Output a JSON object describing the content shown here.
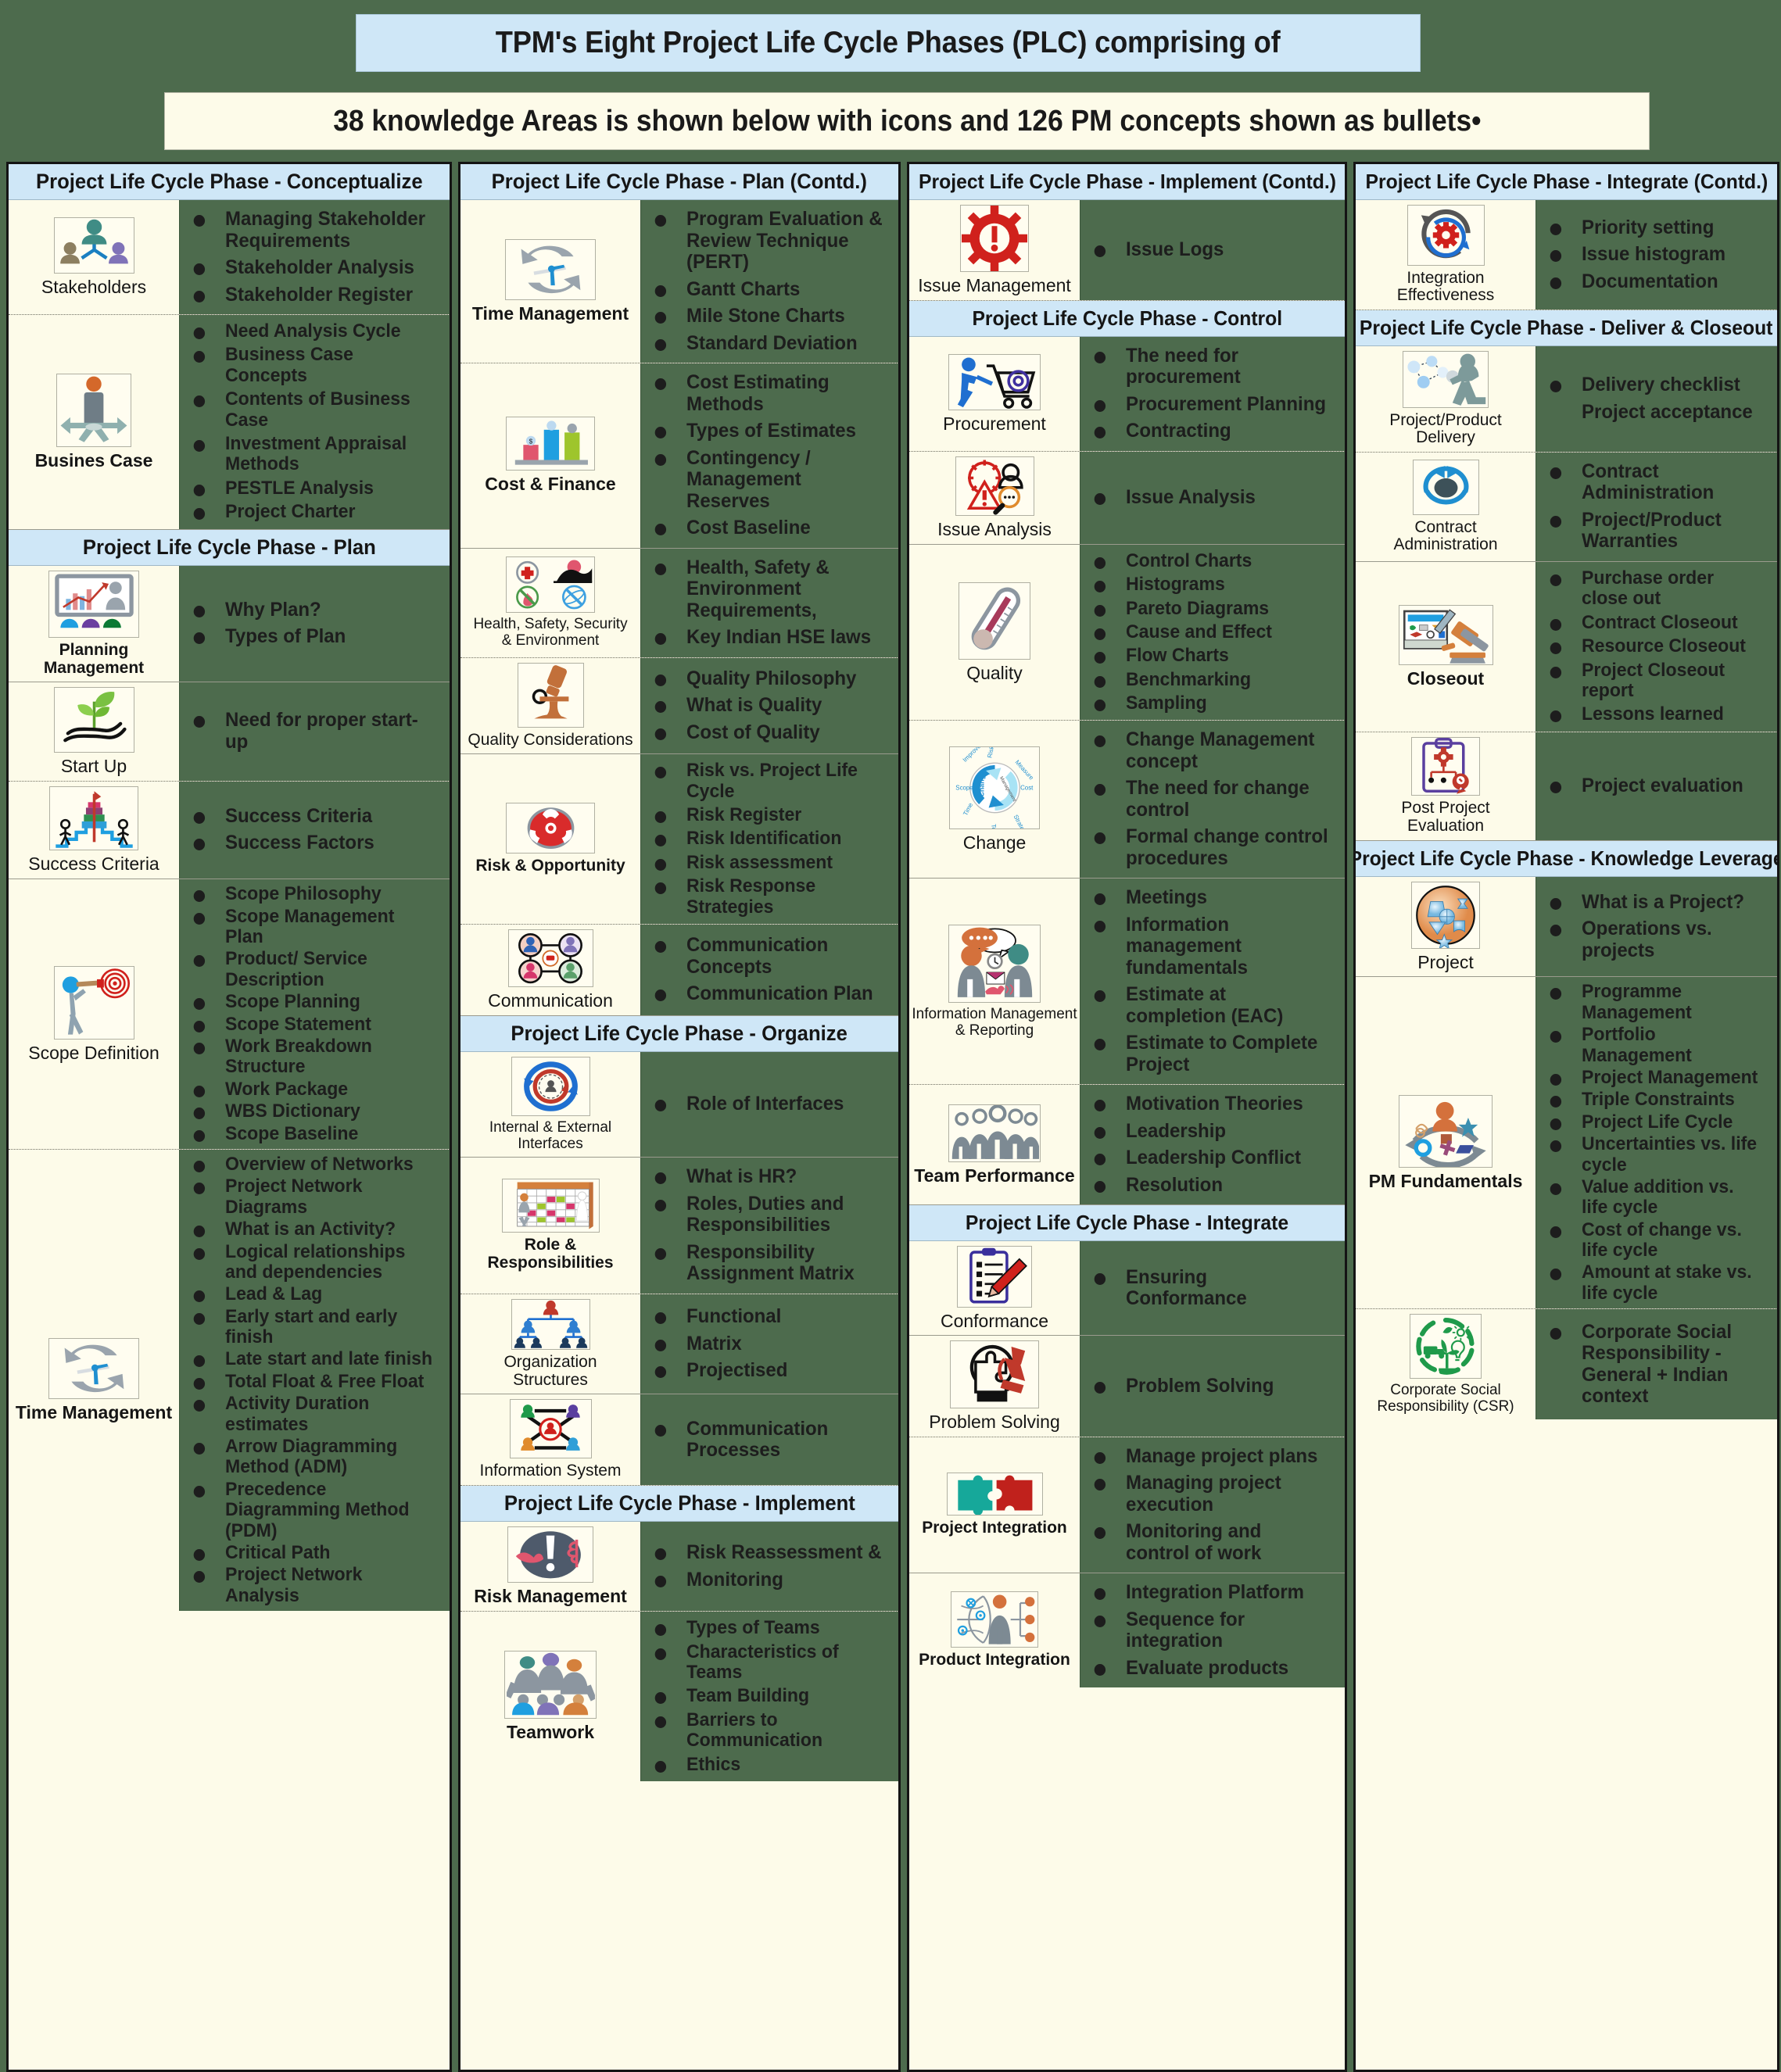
{
  "header": {
    "line1": "TPM's Eight Project Life Cycle Phases (PLC) comprising of",
    "line2": "38 knowledge Areas is shown below with icons and  126 PM concepts shown as bullets•"
  },
  "colors": {
    "bullet_panel_green": "#4d6b4d",
    "icon_panel_cream": "#fdfbe9",
    "phase_band_blue": "#cfe7f7",
    "text_dark": "#1a1a1a"
  },
  "columns": [
    {
      "id": "column-1",
      "blocks": [
        {
          "type": "phase",
          "title": "Project Life Cycle Phase - Conceptualize"
        },
        {
          "type": "ka",
          "icon": "stakeholders-icon",
          "label": "Stakeholders",
          "bullets": [
            "Managing Stakeholder Requirements",
            "Stakeholder Analysis",
            "Stakeholder Register"
          ]
        },
        {
          "type": "ka",
          "icon": "business-case-icon",
          "label": "Busines Case",
          "bullets": [
            "Need Analysis Cycle",
            "Business Case Concepts",
            "Contents of Business Case",
            "Investment Appraisal Methods",
            "PESTLE Analysis",
            "Project Charter"
          ]
        },
        {
          "type": "phase",
          "title": "Project Life Cycle Phase - Plan"
        },
        {
          "type": "ka",
          "icon": "planning-management-icon",
          "label": "Planning Management",
          "bullets": [
            "Why Plan?",
            "Types of Plan"
          ]
        },
        {
          "type": "ka",
          "icon": "start-up-icon",
          "label": "Start Up",
          "bullets": [
            "Need for proper start-up"
          ]
        },
        {
          "type": "ka",
          "icon": "success-criteria-icon",
          "label": "Success Criteria",
          "bullets": [
            "Success Criteria",
            "Success Factors"
          ]
        },
        {
          "type": "ka",
          "icon": "scope-definition-icon",
          "label": "Scope Definition",
          "bullets": [
            "Scope Philosophy",
            "Scope Management Plan",
            "Product/ Service Description",
            "Scope Planning",
            "Scope Statement",
            "Work Breakdown Structure",
            "Work Package",
            "WBS Dictionary",
            "Scope Baseline"
          ]
        },
        {
          "type": "ka",
          "icon": "time-management-icon",
          "label": "Time Management",
          "bullets": [
            "Overview of Networks",
            "Project Network Diagrams",
            "What is an Activity?",
            "Logical relationships and dependencies",
            "Lead & Lag",
            "Early start and early finish",
            "Late start and late finish",
            "Total Float  & Free Float",
            "Activity Duration estimates",
            "Arrow Diagramming Method (ADM)",
            "Precedence Diagramming Method (PDM)",
            "Critical Path",
            "Project Network Analysis"
          ]
        }
      ]
    },
    {
      "id": "column-2",
      "blocks": [
        {
          "type": "phase",
          "title": "Project Life Cycle Phase - Plan (Contd.)"
        },
        {
          "type": "ka",
          "icon": "time-management-icon",
          "label": "Time Management",
          "bullets": [
            "Program Evaluation & Review Technique (PERT)",
            "Gantt Charts",
            "Mile Stone Charts",
            "Standard Deviation"
          ]
        },
        {
          "type": "ka",
          "icon": "cost-finance-icon",
          "label": "Cost & Finance",
          "bullets": [
            "Cost Estimating Methods",
            "Types of Estimates",
            "Contingency / Management Reserves",
            "Cost Baseline"
          ]
        },
        {
          "type": "ka",
          "icon": "hse-icon",
          "label": "Health, Safety, Security & Environment",
          "bullets": [
            "Health, Safety & Environment Requirements,",
            "Key Indian HSE laws"
          ]
        },
        {
          "type": "ka",
          "icon": "quality-considerations-icon",
          "label": "Quality Considerations",
          "bullets": [
            "Quality Philosophy",
            "What is Quality",
            "Cost of Quality"
          ]
        },
        {
          "type": "ka",
          "icon": "risk-opportunity-icon",
          "label": "Risk & Opportunity",
          "bullets": [
            "Risk vs. Project Life Cycle",
            "Risk Register",
            "Risk Identification",
            "Risk assessment",
            "Risk Response Strategies"
          ]
        },
        {
          "type": "ka",
          "icon": "communication-icon",
          "label": "Communication",
          "bullets": [
            "Communication Concepts",
            "Communication Plan"
          ]
        },
        {
          "type": "phase",
          "title": "Project Life Cycle Phase - Organize"
        },
        {
          "type": "ka",
          "icon": "internal-external-interfaces-icon",
          "label": "Internal & External Interfaces",
          "bullets": [
            "Role of Interfaces"
          ]
        },
        {
          "type": "ka",
          "icon": "role-responsibilities-icon",
          "label": "Role & Responsibilities",
          "bullets": [
            "What is HR?",
            "Roles, Duties and Responsibilities",
            "Responsibility Assignment  Matrix"
          ]
        },
        {
          "type": "ka",
          "icon": "organization-structures-icon",
          "label": "Organization Structures",
          "bullets": [
            "Functional",
            "Matrix",
            "Projectised"
          ]
        },
        {
          "type": "ka",
          "icon": "information-system-icon",
          "label": "Information System",
          "bullets": [
            "Communication Processes"
          ]
        },
        {
          "type": "phase",
          "title": "Project Life Cycle Phase - Implement"
        },
        {
          "type": "ka",
          "icon": "risk-management-icon",
          "label": "Risk Management",
          "bullets": [
            "Risk Reassessment &",
            "Monitoring"
          ]
        },
        {
          "type": "ka",
          "icon": "teamwork-icon",
          "label": "Teamwork",
          "bullets": [
            "Types of Teams",
            "Characteristics of Teams",
            "Team Building",
            "Barriers to Communication",
            "Ethics"
          ]
        }
      ]
    },
    {
      "id": "column-3",
      "blocks": [
        {
          "type": "phase",
          "title": "Project Life Cycle Phase - Implement (Contd.)"
        },
        {
          "type": "ka",
          "icon": "issue-management-icon",
          "label": "Issue Management",
          "bullets": [
            "Issue Logs"
          ]
        },
        {
          "type": "phase",
          "title": "Project Life Cycle Phase - Control"
        },
        {
          "type": "ka",
          "icon": "procurement-icon",
          "label": "Procurement",
          "bullets": [
            "The  need  for procurement",
            "Procurement  Planning",
            "Contracting"
          ]
        },
        {
          "type": "ka",
          "icon": "issue-analysis-icon",
          "label": "Issue Analysis",
          "bullets": [
            "Issue  Analysis"
          ]
        },
        {
          "type": "ka",
          "icon": "quality-icon",
          "label": "Quality",
          "bullets": [
            "Control Charts",
            "Histograms",
            "Pareto Diagrams",
            "Cause and Effect",
            "Flow Charts",
            "Benchmarking",
            "Sampling"
          ]
        },
        {
          "type": "ka",
          "icon": "change-icon",
          "label": "Change",
          "bullets": [
            "Change Management concept",
            "The need for change control",
            "Formal change control procedures"
          ]
        },
        {
          "type": "ka",
          "icon": "information-management-reporting-icon",
          "label": "Information Management & Reporting",
          "bullets": [
            "Meetings",
            "Information management fundamentals",
            "Estimate at completion (EAC)",
            "Estimate to Complete Project"
          ]
        },
        {
          "type": "ka",
          "icon": "team-performance-icon",
          "label": "Team Performance",
          "bullets": [
            "Motivation Theories",
            "Leadership",
            "Leadership Conflict",
            "Resolution"
          ]
        },
        {
          "type": "phase",
          "title": "Project Life Cycle Phase - Integrate"
        },
        {
          "type": "ka",
          "icon": "conformance-icon",
          "label": "Conformance",
          "bullets": [
            "Ensuring Conformance"
          ]
        },
        {
          "type": "ka",
          "icon": "problem-solving-icon",
          "label": "Problem Solving",
          "bullets": [
            "Problem Solving"
          ]
        },
        {
          "type": "ka",
          "icon": "project-integration-icon",
          "label": "Project Integration",
          "bullets": [
            "Manage project plans",
            "Managing project execution",
            "Monitoring and control of work"
          ]
        },
        {
          "type": "ka",
          "icon": "product-integration-icon",
          "label": "Product Integration",
          "bullets": [
            "Integration Platform",
            "Sequence for integration",
            "Evaluate products"
          ]
        }
      ]
    },
    {
      "id": "column-4",
      "blocks": [
        {
          "type": "phase",
          "title": "Project Life Cycle Phase - Integrate (Contd.)"
        },
        {
          "type": "ka",
          "icon": "integration-effectiveness-icon",
          "label": "Integration Effectiveness",
          "bullets": [
            "Priority setting",
            "Issue histogram",
            "Documentation"
          ]
        },
        {
          "type": "phase",
          "title": "Project Life Cycle Phase - Deliver & Closeout"
        },
        {
          "type": "ka",
          "icon": "project-product-delivery-icon",
          "label": "Project/Product Delivery",
          "bullets": [
            "Delivery checklist",
            "Project acceptance"
          ]
        },
        {
          "type": "ka",
          "icon": "contract-administration-icon",
          "label": "Contract Administration",
          "bullets": [
            "Contract Administration",
            "Project/Product Warranties"
          ]
        },
        {
          "type": "ka",
          "icon": "closeout-icon",
          "label": "Closeout",
          "bullets": [
            "Purchase order close out",
            "Contract Closeout",
            "Resource Closeout",
            "Project Closeout report",
            "Lessons learned"
          ]
        },
        {
          "type": "ka",
          "icon": "post-project-evaluation-icon",
          "label": "Post Project Evaluation",
          "bullets": [
            "Project evaluation"
          ]
        },
        {
          "type": "phase",
          "title": "Project Life Cycle Phase - Knowledge Leverage"
        },
        {
          "type": "ka",
          "icon": "project-icon",
          "label": "Project",
          "bullets": [
            "What is a Project?",
            "Operations vs. projects"
          ]
        },
        {
          "type": "ka",
          "icon": "pm-fundamentals-icon",
          "label": "PM Fundamentals",
          "bullets": [
            "Programme Management",
            "Portfolio Management",
            "Project Management",
            "Triple Constraints",
            "Project Life Cycle",
            "Uncertainties vs. life cycle",
            "Value addition vs. life cycle",
            "Cost of change vs. life cycle",
            "Amount at stake vs. life cycle"
          ]
        },
        {
          "type": "ka",
          "icon": "csr-icon",
          "label": "Corporate Social Responsibility (CSR)",
          "bullets": [
            "Corporate Social Responsibility - General + Indian context"
          ]
        }
      ]
    }
  ]
}
